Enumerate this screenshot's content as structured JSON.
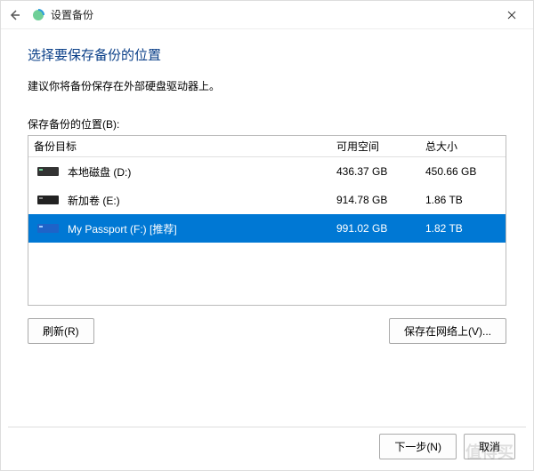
{
  "titlebar": {
    "title": "设置备份"
  },
  "content": {
    "heading": "选择要保存备份的位置",
    "subtext": "建议你将备份保存在外部硬盘驱动器上。",
    "list_label": "保存备份的位置(B):"
  },
  "columns": {
    "name": "备份目标",
    "free": "可用空间",
    "total": "总大小"
  },
  "drives": [
    {
      "label": "本地磁盘 (D:)",
      "free": "436.37 GB",
      "total": "450.66 GB",
      "selected": false,
      "icon": "hdd-green"
    },
    {
      "label": "新加卷 (E:)",
      "free": "914.78 GB",
      "total": "1.86 TB",
      "selected": false,
      "icon": "hdd-dark"
    },
    {
      "label": "My Passport (F:) [推荐]",
      "free": "991.02 GB",
      "total": "1.82 TB",
      "selected": true,
      "icon": "hdd-blue"
    }
  ],
  "buttons": {
    "refresh": "刷新(R)",
    "network": "保存在网络上(V)...",
    "next": "下一步(N)",
    "cancel": "取消"
  },
  "watermark": "值得买"
}
